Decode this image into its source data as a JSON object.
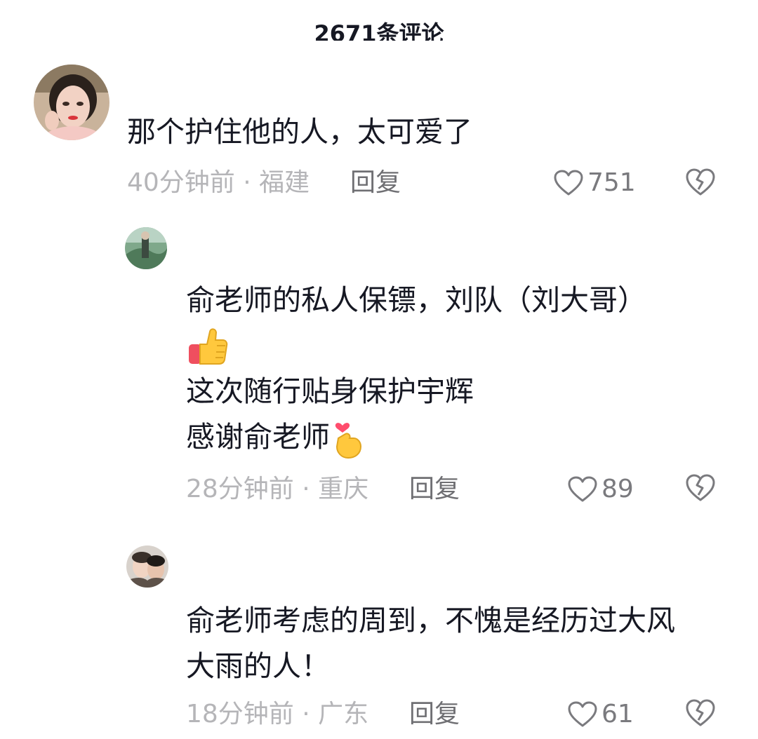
{
  "header": {
    "title": "2671条评论"
  },
  "comments": [
    {
      "text_lines": [
        "那个护住他的人，太可爱了"
      ],
      "time": "40分钟前",
      "location": "福建",
      "reply_label": "回复",
      "likes": "751"
    },
    {
      "text_line_1": "俞老师的私人保镖，刘队（刘大哥）",
      "text_line_2_emoji": "thumbs-up-emoji",
      "text_line_3": "这次随行贴身保护宇辉",
      "text_line_4": "感谢俞老师",
      "text_line_4_emoji": "finger-heart-emoji",
      "time": "28分钟前",
      "location": "重庆",
      "reply_label": "回复",
      "likes": "89"
    },
    {
      "text_line_1": "俞老师考虑的周到，不愧是经历过大风",
      "text_line_2": "大雨的人！",
      "time": "18分钟前",
      "location": "广东",
      "reply_label": "回复",
      "likes": "61"
    }
  ],
  "meta_separator": " · ",
  "icons": {
    "like": "heart-outline-icon",
    "dislike": "broken-heart-icon"
  },
  "colors": {
    "text": "#161823",
    "meta": "#b5b5b8",
    "reply": "#6f6f73"
  }
}
